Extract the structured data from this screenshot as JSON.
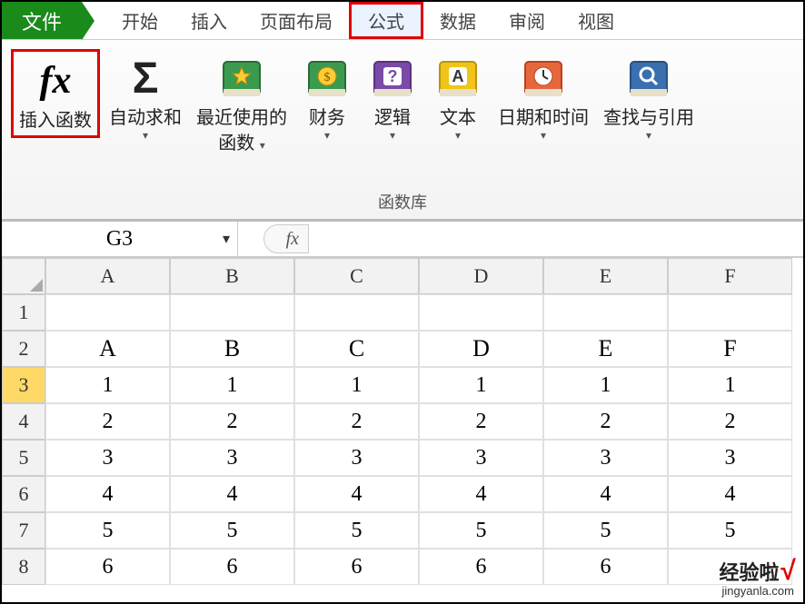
{
  "tabs": {
    "file": "文件",
    "home": "开始",
    "insert": "插入",
    "page_layout": "页面布局",
    "formulas": "公式",
    "data": "数据",
    "review": "审阅",
    "view": "视图"
  },
  "ribbon": {
    "insert_function": "插入函数",
    "autosum": "自动求和",
    "recently_used_1": "最近使用的",
    "recently_used_2": "函数",
    "financial": "财务",
    "logical": "逻辑",
    "text": "文本",
    "date_time": "日期和时间",
    "lookup_ref": "查找与引用",
    "group_label": "函数库"
  },
  "formula_bar": {
    "name_box_value": "G3",
    "fx_label": "fx",
    "formula_value": ""
  },
  "sheet": {
    "col_headers": [
      "A",
      "B",
      "C",
      "D",
      "E",
      "F"
    ],
    "row_headers": [
      "1",
      "2",
      "3",
      "4",
      "5",
      "6",
      "7",
      "8"
    ],
    "selected_row": "3",
    "rows": [
      [
        "",
        "",
        "",
        "",
        "",
        ""
      ],
      [
        "A",
        "B",
        "C",
        "D",
        "E",
        "F"
      ],
      [
        "1",
        "1",
        "1",
        "1",
        "1",
        "1"
      ],
      [
        "2",
        "2",
        "2",
        "2",
        "2",
        "2"
      ],
      [
        "3",
        "3",
        "3",
        "3",
        "3",
        "3"
      ],
      [
        "4",
        "4",
        "4",
        "4",
        "4",
        "4"
      ],
      [
        "5",
        "5",
        "5",
        "5",
        "5",
        "5"
      ],
      [
        "6",
        "6",
        "6",
        "6",
        "6",
        ""
      ]
    ]
  },
  "watermark": {
    "brand": "经验啦",
    "url": "jingyanla.com"
  },
  "icons": {
    "fx": "fx",
    "sigma": "Σ",
    "dropdown": "▾"
  }
}
